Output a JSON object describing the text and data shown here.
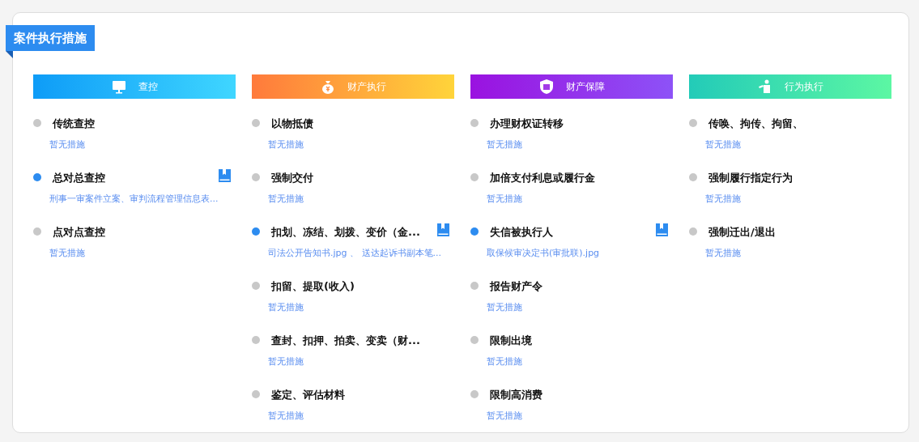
{
  "panel": {
    "title": "案件执行措施"
  },
  "groups": [
    {
      "title": "查控",
      "kind": "monitor",
      "items": [
        {
          "title": "传统查控",
          "detail": "暂无措施",
          "active": false
        },
        {
          "title": "总对总查控",
          "detail": "刑事一审案件立案、审判流程管理信息表...",
          "active": true
        },
        {
          "title": "点对点查控",
          "detail": "暂无措施",
          "active": false
        }
      ]
    },
    {
      "title": "财产执行",
      "kind": "moneybag",
      "items": [
        {
          "title": "以物抵债",
          "detail": "暂无措施",
          "active": false
        },
        {
          "title": "强制交付",
          "detail": "暂无措施",
          "active": false
        },
        {
          "title": "扣划、冻结、划拨、变价（金...",
          "detail": "司法公开告知书.jpg 、 送达起诉书副本笔...",
          "active": true
        },
        {
          "title": "扣留、提取(收入)",
          "detail": "暂无措施",
          "active": false
        },
        {
          "title": "查封、扣押、拍卖、变卖（财...",
          "detail": "暂无措施",
          "active": false
        },
        {
          "title": "鉴定、评估材料",
          "detail": "暂无措施",
          "active": false
        }
      ]
    },
    {
      "title": "财产保障",
      "kind": "shield",
      "items": [
        {
          "title": "办理财权证转移",
          "detail": "暂无措施",
          "active": false
        },
        {
          "title": "加倍支付利息或履行金",
          "detail": "暂无措施",
          "active": false
        },
        {
          "title": "失信被执行人",
          "detail": "取保候审决定书(审批联).jpg",
          "active": true
        },
        {
          "title": "报告财产令",
          "detail": "暂无措施",
          "active": false
        },
        {
          "title": "限制出境",
          "detail": "暂无措施",
          "active": false
        },
        {
          "title": "限制高消费",
          "detail": "暂无措施",
          "active": false
        }
      ]
    },
    {
      "title": "行为执行",
      "kind": "person",
      "items": [
        {
          "title": "传唤、拘传、拘留、",
          "detail": "暂无措施",
          "active": false
        },
        {
          "title": "强制履行指定行为",
          "detail": "暂无措施",
          "active": false
        },
        {
          "title": "强制迁出/退出",
          "detail": "暂无措施",
          "active": false
        }
      ]
    }
  ]
}
